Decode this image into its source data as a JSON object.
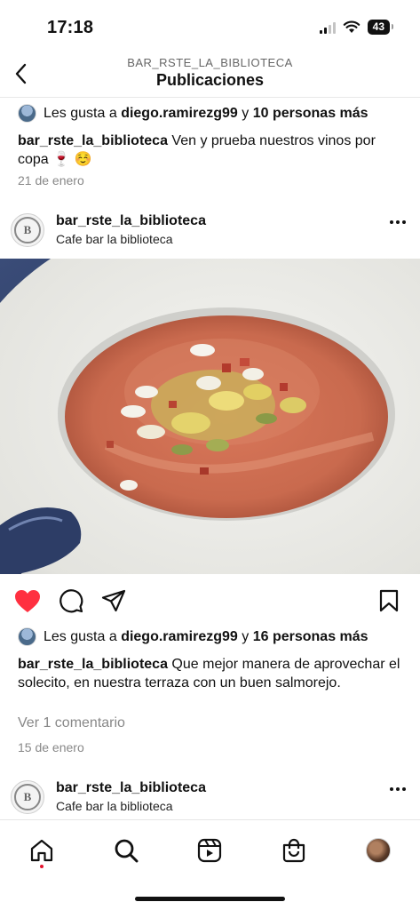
{
  "status_bar": {
    "time": "17:18",
    "battery": "43"
  },
  "header": {
    "account": "BAR_RSTE_LA_BIBLIOTECA",
    "title": "Publicaciones"
  },
  "posts": [
    {
      "likes_prefix": "Les gusta a",
      "likes_user": "diego.ramirezg99",
      "likes_joiner": "y",
      "likes_others": "10 personas más",
      "caption_user": "bar_rste_la_biblioteca",
      "caption_text": "Ven y prueba nuestros vinos por copa 🍷 ☺️",
      "date": "21 de enero"
    },
    {
      "username": "bar_rste_la_biblioteca",
      "location": "Cafe bar la biblioteca",
      "avatar_letter": "B",
      "likes_prefix": "Les gusta a",
      "likes_user": "diego.ramirezg99",
      "likes_joiner": "y",
      "likes_others": "16 personas más",
      "caption_user": "bar_rste_la_biblioteca",
      "caption_text": "Que mejor manera de aprovechar el solecito, en nuestra terraza con un buen salmorejo.",
      "comments_link": "Ver 1 comentario",
      "date": "15 de enero",
      "liked": true
    },
    {
      "username": "bar_rste_la_biblioteca",
      "location": "Cafe bar la biblioteca",
      "avatar_letter": "B"
    }
  ],
  "colors": {
    "like_red": "#ff3040",
    "notification_dot": "#e4132d",
    "text_secondary": "#888888"
  },
  "icons": {
    "back": "chevron-left-icon",
    "like": "heart-icon",
    "comment": "comment-bubble-icon",
    "share": "paper-plane-icon",
    "save": "bookmark-icon",
    "nav": [
      "home-icon",
      "search-icon",
      "reels-icon",
      "shop-icon",
      "profile-avatar"
    ]
  }
}
